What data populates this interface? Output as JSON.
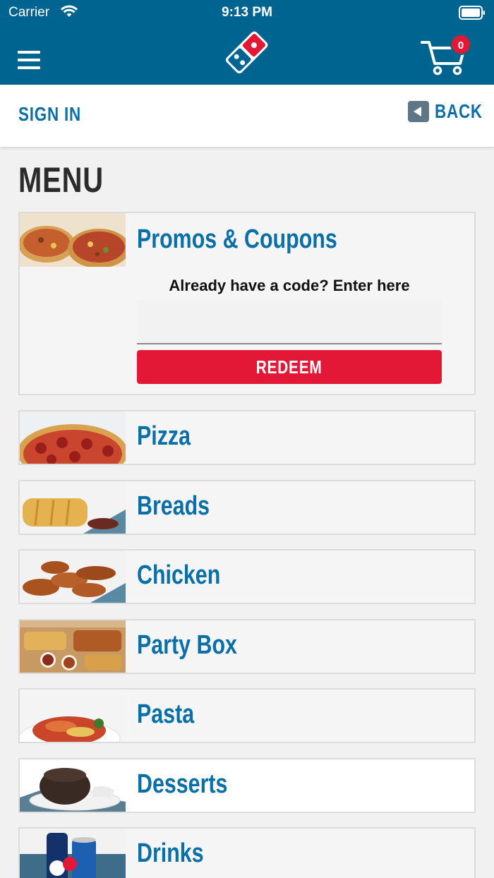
{
  "status_bar": {
    "carrier": "Carrier",
    "time": "9:13 PM"
  },
  "header": {
    "cart_count": "0",
    "brand_color": "#006491"
  },
  "subnav": {
    "sign_in": "SIGN IN",
    "back": "BACK"
  },
  "page_title": "MENU",
  "promo": {
    "title": "Promos & Coupons",
    "prompt": "Already have a code? Enter here",
    "input_value": "",
    "redeem_label": "REDEEM"
  },
  "categories": [
    {
      "label": "Pizza"
    },
    {
      "label": "Breads"
    },
    {
      "label": "Chicken"
    },
    {
      "label": "Party Box"
    },
    {
      "label": "Pasta"
    },
    {
      "label": "Desserts"
    },
    {
      "label": "Drinks"
    }
  ],
  "colors": {
    "accent_blue": "#0a6fa6",
    "accent_red": "#e31837"
  }
}
